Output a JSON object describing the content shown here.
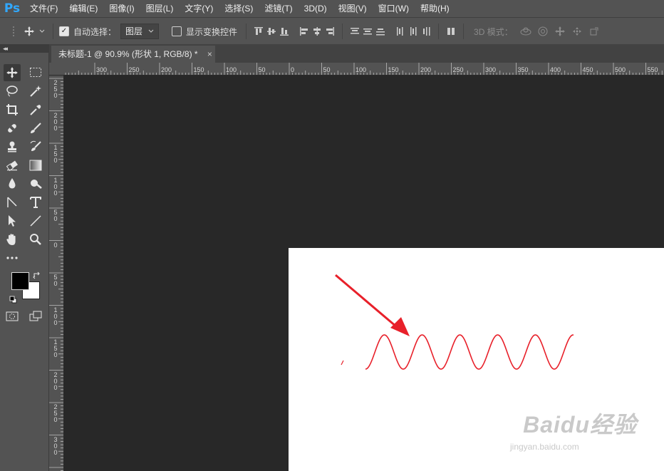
{
  "app": {
    "logo": "Ps"
  },
  "menu": [
    "文件(F)",
    "编辑(E)",
    "图像(I)",
    "图层(L)",
    "文字(Y)",
    "选择(S)",
    "滤镜(T)",
    "3D(D)",
    "视图(V)",
    "窗口(W)",
    "帮助(H)"
  ],
  "options": {
    "auto_select_label": "自动选择：",
    "auto_select_checked": true,
    "auto_select_target": "图层",
    "show_transform_label": "显示变换控件",
    "show_transform_checked": false,
    "mode_3d_label": "3D 模式："
  },
  "toolbar": {
    "collapse_glyph": "◂◂"
  },
  "document": {
    "tab_title": "未标题-1 @ 90.9% (形状 1, RGB/8) *",
    "close_glyph": "×"
  },
  "ruler": {
    "h_labels": [
      "300",
      "250",
      "200",
      "150",
      "100",
      "50",
      "0",
      "50",
      "100",
      "150",
      "200",
      "250",
      "300",
      "350",
      "400",
      "450",
      "500",
      "550"
    ],
    "v_labels": [
      "250",
      "200",
      "150",
      "100",
      "50",
      "0",
      "50",
      "100",
      "150",
      "200",
      "250",
      "300"
    ]
  },
  "canvas": {
    "background": "#ffffff",
    "wave_color": "#e8202a",
    "arrow_color": "#e8202a"
  },
  "watermark": {
    "brand": "Baidu经验",
    "url": "jingyan.baidu.com"
  }
}
